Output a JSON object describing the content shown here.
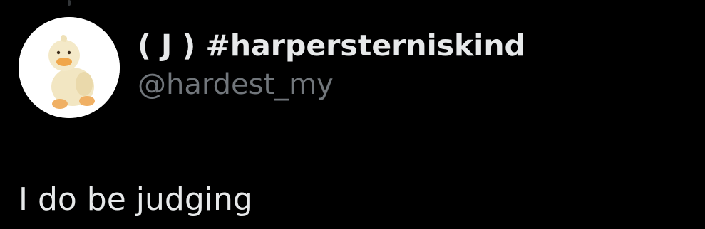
{
  "tweet": {
    "author": {
      "display_name": "( J ) #harpersterniskind",
      "handle": "@hardest_my",
      "avatar_icon": "duck-plush-avatar"
    },
    "text": "I do be judging"
  },
  "colors": {
    "background": "#000000",
    "primary_text": "#e7e9ea",
    "secondary_text": "#71767b",
    "thread_line": "#333639"
  }
}
